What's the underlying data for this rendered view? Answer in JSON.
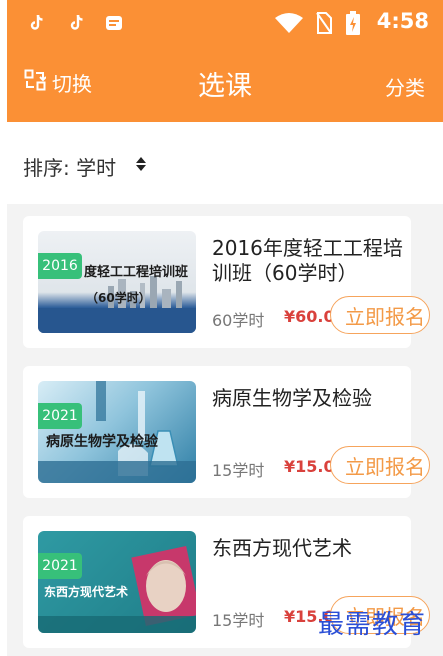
{
  "status_bar": {
    "time": "4:58",
    "icons": [
      "tiktok-icon",
      "tiktok-icon",
      "message-icon",
      "wifi-icon",
      "no-sim-icon",
      "battery-charging-icon"
    ]
  },
  "app_bar": {
    "switch_label": "切换",
    "title": "选课",
    "category_label": "分类"
  },
  "sort": {
    "label": "排序: 学时"
  },
  "courses": [
    {
      "badge": "2016",
      "thumb_text_1": "度轻工工程培训班",
      "thumb_text_2": "（60学时）",
      "title": "2016年度轻工工程培训班（60学时）",
      "hours": "60学时",
      "price": "¥60.0",
      "button": "立即报名"
    },
    {
      "badge": "2021",
      "thumb_text_1": "病原生物学及检验",
      "title": "病原生物学及检验",
      "hours": "15学时",
      "price": "¥15.0",
      "button": "立即报名"
    },
    {
      "badge": "2021",
      "thumb_text_1": "东西方现代艺术",
      "title": "东西方现代艺术",
      "hours": "15学时",
      "price": "¥15.0",
      "button": "立即报名"
    }
  ],
  "watermark": "最需教育",
  "colors": {
    "accent": "#fb9035",
    "badge": "#37c07a",
    "price": "#d9413c"
  }
}
